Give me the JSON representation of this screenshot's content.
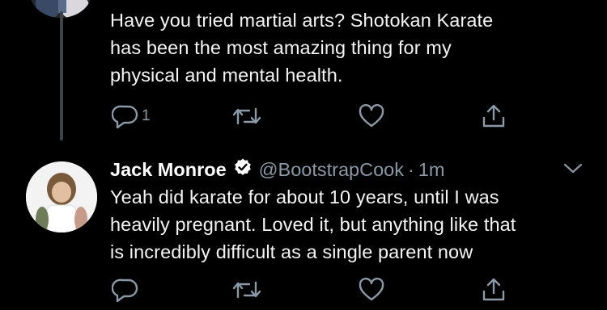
{
  "parent_tweet": {
    "text_lines": [
      "Have you tried martial arts? Shotokan Karate",
      "has been the most amazing thing for my",
      "physical and mental health."
    ],
    "reply_count": "1"
  },
  "reply_tweet": {
    "author_name": "Jack Monroe",
    "author_handle": "@BootstrapCook",
    "separator": "·",
    "timestamp": "1m",
    "text_lines": [
      "Yeah did karate for about 10 years, until I was",
      "heavily pregnant. Loved it, but anything like that",
      "is incredibly difficult as a single parent now"
    ]
  },
  "colors": {
    "background": "#000000",
    "text": "#f4f4f4",
    "secondary": "#8b98a5",
    "icon": "#8b98a5"
  },
  "icons": [
    "reply-icon",
    "retweet-icon",
    "like-icon",
    "share-icon",
    "verified-badge-icon",
    "chevron-down-icon"
  ]
}
